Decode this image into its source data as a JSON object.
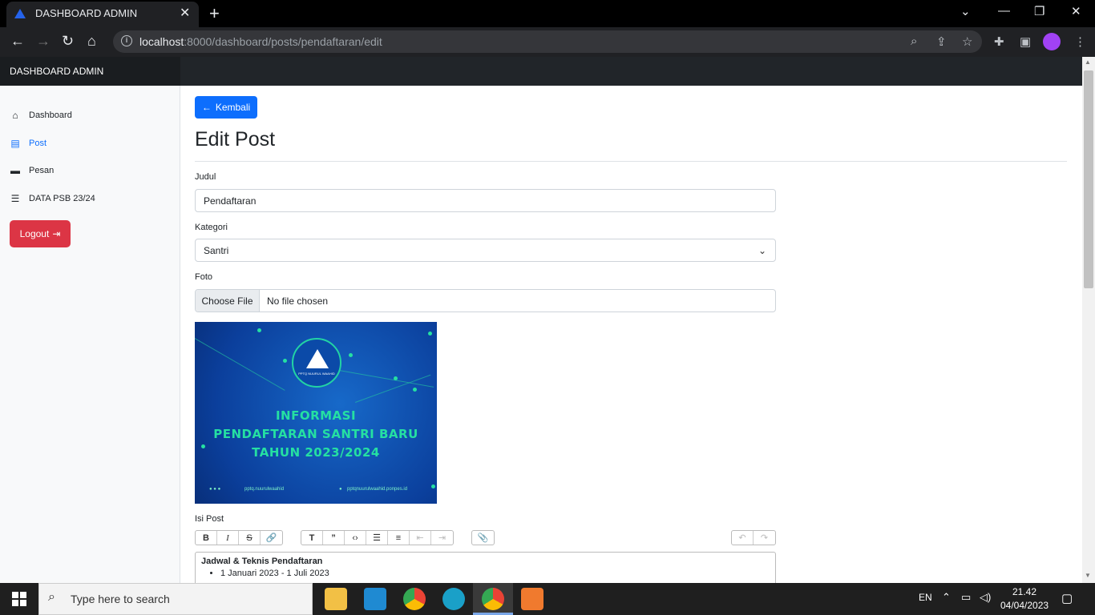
{
  "browser": {
    "tab_title": "DASHBOARD ADMIN",
    "url_host": "localhost",
    "url_rest": ":8000/dashboard/posts/pendaftaran/edit"
  },
  "app": {
    "brand": "DASHBOARD ADMIN"
  },
  "sidebar": {
    "items": [
      {
        "label": "Dashboard",
        "icon": "house-icon",
        "active": false
      },
      {
        "label": "Post",
        "icon": "document-icon",
        "active": true
      },
      {
        "label": "Pesan",
        "icon": "chat-icon",
        "active": false
      },
      {
        "label": "DATA PSB 23/24",
        "icon": "users-list-icon",
        "active": false
      }
    ],
    "logout_label": "Logout"
  },
  "main": {
    "back_label": "Kembali",
    "title": "Edit Post",
    "judul_label": "Judul",
    "judul_value": "Pendaftaran",
    "kategori_label": "Kategori",
    "kategori_value": "Santri",
    "foto_label": "Foto",
    "choose_file_label": "Choose File",
    "file_status": "No file chosen",
    "isi_label": "Isi Post",
    "editor_heading": "Jadwal & Teknis Pendaftaran",
    "editor_items": [
      "1 Januari 2023 - 1 Juli 2023"
    ]
  },
  "preview": {
    "logo_caption": "PPTQ NUURUL WAAHID",
    "line1": "INFORMASI",
    "line2": "PENDAFTARAN SANTRI BARU",
    "line3": "TAHUN 2023/2024",
    "footer_left": "pptq.nuurulwaahid",
    "footer_right": "pptqnuurulwaahid.ponpes.id"
  },
  "taskbar": {
    "search_placeholder": "Type here to search",
    "lang": "EN",
    "time": "21.42",
    "date": "04/04/2023"
  },
  "colors": {
    "primary": "#0d6efd",
    "danger": "#dc3545",
    "nav_dark": "#212529"
  }
}
